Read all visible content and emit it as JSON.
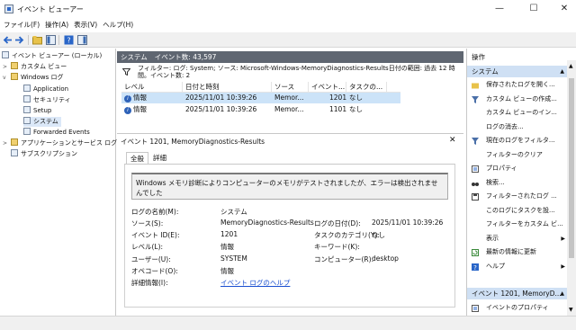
{
  "window": {
    "title": "イベント ビューアー",
    "controls": [
      "—",
      "☐",
      "✕"
    ]
  },
  "menu": [
    "ファイル(F)",
    "操作(A)",
    "表示(V)",
    "ヘルプ(H)"
  ],
  "tree": [
    {
      "label": "イベント ビューアー (ローカル)",
      "icon": "event-viewer-icon"
    },
    {
      "label": "カスタム ビュー",
      "icon": "folder-icon"
    },
    {
      "label": "Windows ログ",
      "icon": "folder-icon"
    },
    {
      "label": "Application",
      "icon": "log-icon"
    },
    {
      "label": "セキュリティ",
      "icon": "log-icon"
    },
    {
      "label": "Setup",
      "icon": "log-icon"
    },
    {
      "label": "システム",
      "icon": "log-icon"
    },
    {
      "label": "Forwarded Events",
      "icon": "log-icon"
    },
    {
      "label": "アプリケーションとサービス ログ",
      "icon": "folder-icon"
    },
    {
      "label": "サブスクリプション",
      "icon": "subscription-icon"
    }
  ],
  "center": {
    "header_name": "システム",
    "header_count": "イベント数: 43,597",
    "filter_line1": "フィルター: ログ: System; ソース: Microsoft-Windows-MemoryDiagnostics-Results日付の範囲: 過去 12 時",
    "filter_line2": "間。イベント数: 2",
    "columns": [
      "レベル",
      "日付と時刻",
      "ソース",
      "イベント...",
      "タスクの..."
    ],
    "rows": [
      {
        "level": "情報",
        "datetime": "2025/11/01 10:39:26",
        "source": "Memor...",
        "event_id": "1201",
        "task": "なし"
      },
      {
        "level": "情報",
        "datetime": "2025/11/01 10:39:26",
        "source": "Memor...",
        "event_id": "1101",
        "task": "なし"
      }
    ]
  },
  "detail": {
    "title": "イベント 1201, MemoryDiagnostics-Results",
    "close": "✕",
    "tabs": [
      "全般",
      "詳細"
    ],
    "message": "Windows メモリ診断によりコンピューターのメモリがテストされましたが、エラーは検出されませんでした",
    "log_name_label": "ログの名前(M):",
    "log_name": "システム",
    "source_label": "ソース(S):",
    "source": "MemoryDiagnostics-Results",
    "logged_label": "ログの日付(D):",
    "logged": "2025/11/01 10:39:26",
    "event_id_label": "イベント ID(E):",
    "event_id": "1201",
    "task_label": "タスクのカテゴリ(Y):",
    "task": "なし",
    "level_label": "レベル(L):",
    "level": "情報",
    "keywords_label": "キーワード(K):",
    "user_label": "ユーザー(U):",
    "user": "SYSTEM",
    "computer_label": "コンピューター(R):",
    "computer": "desktop",
    "opcode_label": "オペコード(O):",
    "opcode": "情報",
    "more_info_label": "詳細情報(I):",
    "more_info": "イベント ログのヘルプ"
  },
  "actions": {
    "title": "操作",
    "section1": "システム",
    "items": [
      {
        "label": "保存されたログを開く...",
        "icon": "open-folder-icon"
      },
      {
        "label": "カスタム ビューの作成...",
        "icon": "filter-icon"
      },
      {
        "label": "カスタム ビューのイン...",
        "icon": ""
      },
      {
        "label": "ログの消去...",
        "icon": ""
      },
      {
        "label": "現在のログをフィルタ...",
        "icon": "filter-icon"
      },
      {
        "label": "フィルターのクリア",
        "icon": ""
      },
      {
        "label": "プロパティ",
        "icon": "properties-icon"
      },
      {
        "label": "検索...",
        "icon": "binoculars-icon"
      },
      {
        "label": "フィルターされたログ ...",
        "icon": "save-icon"
      },
      {
        "label": "このログにタスクを設...",
        "icon": ""
      },
      {
        "label": "フィルターをカスタム ビ...",
        "icon": ""
      },
      {
        "label": "表示",
        "icon": ""
      },
      {
        "label": "最新の情報に更新",
        "icon": "refresh-icon"
      },
      {
        "label": "ヘルプ",
        "icon": "help-icon"
      }
    ],
    "section2": "イベント 1201, MemoryD...",
    "items2": [
      {
        "label": "イベントのプロパティ",
        "icon": "properties-icon"
      }
    ]
  },
  "colors": {
    "section_header": "#5f6671",
    "selection": "#cce3f8",
    "link": "#1a4fd0",
    "action_header": "#cfe0f4"
  }
}
